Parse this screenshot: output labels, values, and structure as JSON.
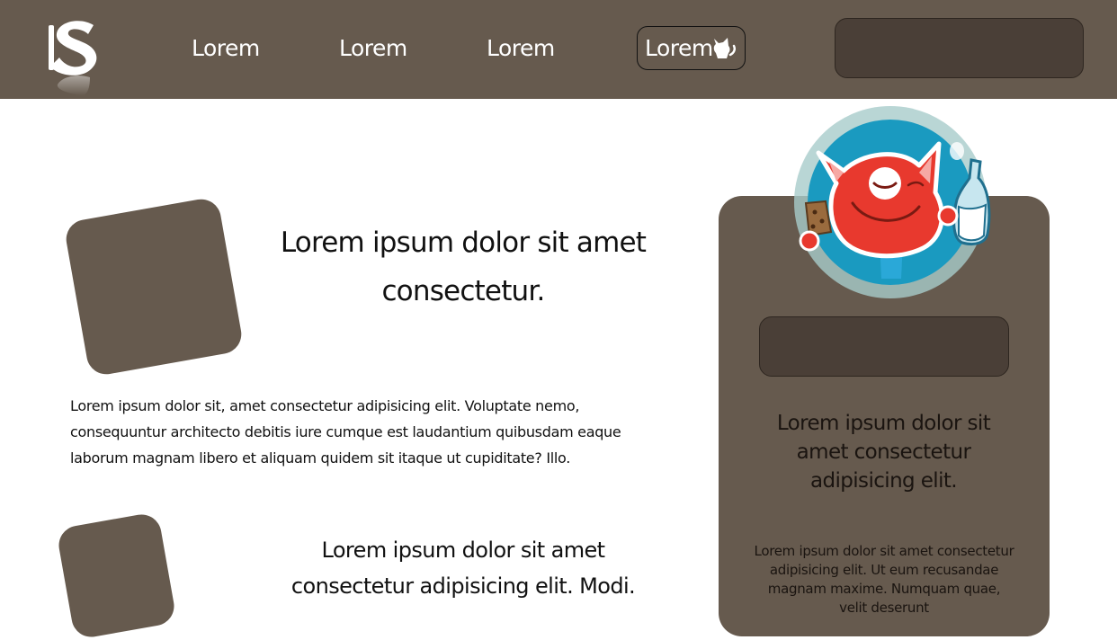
{
  "header": {
    "logo_letter": "S",
    "nav": [
      {
        "label": "Lorem"
      },
      {
        "label": "Lorem"
      },
      {
        "label": "Lorem"
      },
      {
        "label": "Lorem",
        "active": true,
        "icon": "cat-icon"
      }
    ],
    "search": {
      "value": "",
      "placeholder": ""
    }
  },
  "main": {
    "headline_1": "Lorem ipsum dolor sit amet consectetur.",
    "paragraph_1": "Lorem ipsum dolor sit, amet consectetur adipisicing elit. Voluptate nemo, consequuntur architecto debitis iure cumque est laudantium quibusdam eaque laborum magnam libero et aliquam quidem sit itaque ut cupiditate? Illo.",
    "headline_2": "Lorem ipsum dolor sit amet consectetur adipisicing elit. Modi."
  },
  "sidebar": {
    "mascot_icon": "cat-mascot-milk-cookie-icon",
    "input": {
      "value": "",
      "placeholder": ""
    },
    "heading": "Lorem ipsum dolor sit amet consectetur adipisicing elit.",
    "text": "Lorem ipsum dolor sit amet consectetur adipisicing elit. Ut eum recusandae magnam maxime. Numquam quae, velit deserunt"
  },
  "colors": {
    "brand_brown": "#665a4e",
    "input_dark": "#4a3f37",
    "mascot_red": "#e8392e",
    "mascot_blue": "#1a9ac0"
  }
}
